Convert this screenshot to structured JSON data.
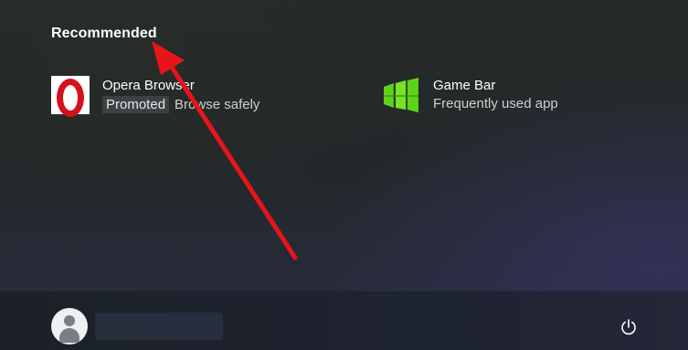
{
  "recommended": {
    "title": "Recommended",
    "items": [
      {
        "name": "Opera Browser",
        "badge": "Promoted",
        "subtitle": "Browse safely",
        "icon": "opera-logo-icon"
      },
      {
        "name": "Game Bar",
        "subtitle": "Frequently used app",
        "icon": "game-bar-icon"
      }
    ]
  },
  "footer": {
    "user_icon": "user-avatar-icon",
    "power_icon": "power-icon"
  },
  "annotation": {
    "arrow_color": "#e8141b"
  }
}
